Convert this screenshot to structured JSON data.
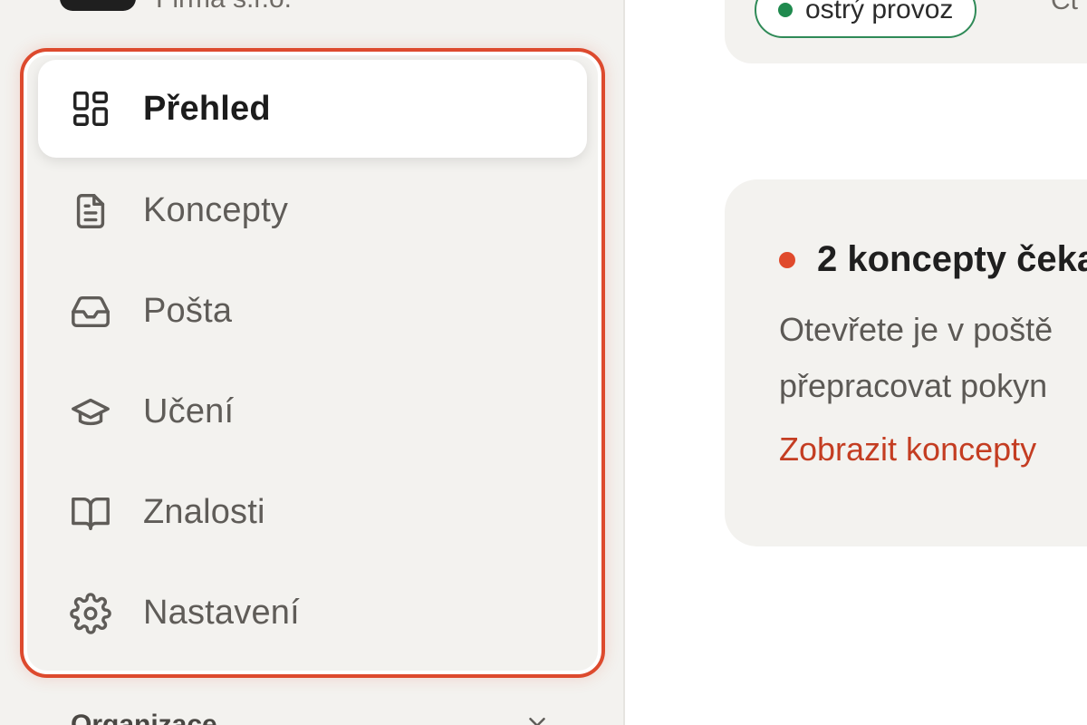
{
  "org": {
    "name": "Firma s.r.o."
  },
  "nav": {
    "items": [
      {
        "label": "Přehled",
        "icon": "dashboard-icon",
        "active": true
      },
      {
        "label": "Koncepty",
        "icon": "document-icon",
        "active": false
      },
      {
        "label": "Pošta",
        "icon": "inbox-icon",
        "active": false
      },
      {
        "label": "Učení",
        "icon": "graduation-cap-icon",
        "active": false
      },
      {
        "label": "Znalosti",
        "icon": "book-icon",
        "active": false
      },
      {
        "label": "Nastavení",
        "icon": "gear-icon",
        "active": false
      }
    ],
    "section_label": "Organizace"
  },
  "status": {
    "badge": "ostrý provoz",
    "extra": "Čt"
  },
  "alert": {
    "title": "2 koncepty čeka",
    "body_line1": "Otevřete je v poště",
    "body_line2": "přepracovat pokyn",
    "link": "Zobrazit koncepty"
  },
  "colors": {
    "accent": "#dd4a2e",
    "sidebar_bg": "#f3f2ef",
    "success": "#1f8a4e",
    "link": "#c43d22"
  }
}
